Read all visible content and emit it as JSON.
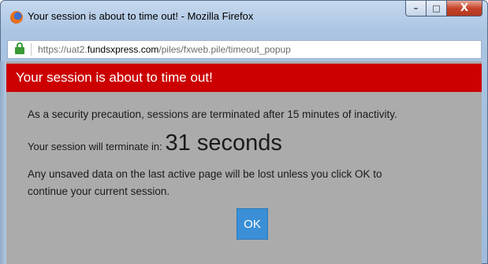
{
  "window": {
    "title": "Your session is about to time out! - Mozilla Firefox",
    "buttons": {
      "minimize": "–",
      "maximize": "□",
      "close": "X"
    }
  },
  "urlbar": {
    "prefix": "https://uat2.",
    "domain": "fundsxpress.com",
    "path": "/piles/fxweb.pile/timeout_popup"
  },
  "dialog": {
    "heading": "Your session is about to time out!",
    "security_notice": "As a security precaution, sessions are terminated after 15 minutes of inactivity.",
    "countdown_lead": "Your session will terminate in:",
    "countdown_value": "31 seconds",
    "warning_line1": "Any unsaved data on the last active page will be lost unless you click OK to",
    "warning_line2": "continue your current session.",
    "ok_label": "OK"
  },
  "colors": {
    "banner": "#cc0000",
    "ok_button": "#3a8fd6",
    "page_bg": "#ababab"
  }
}
